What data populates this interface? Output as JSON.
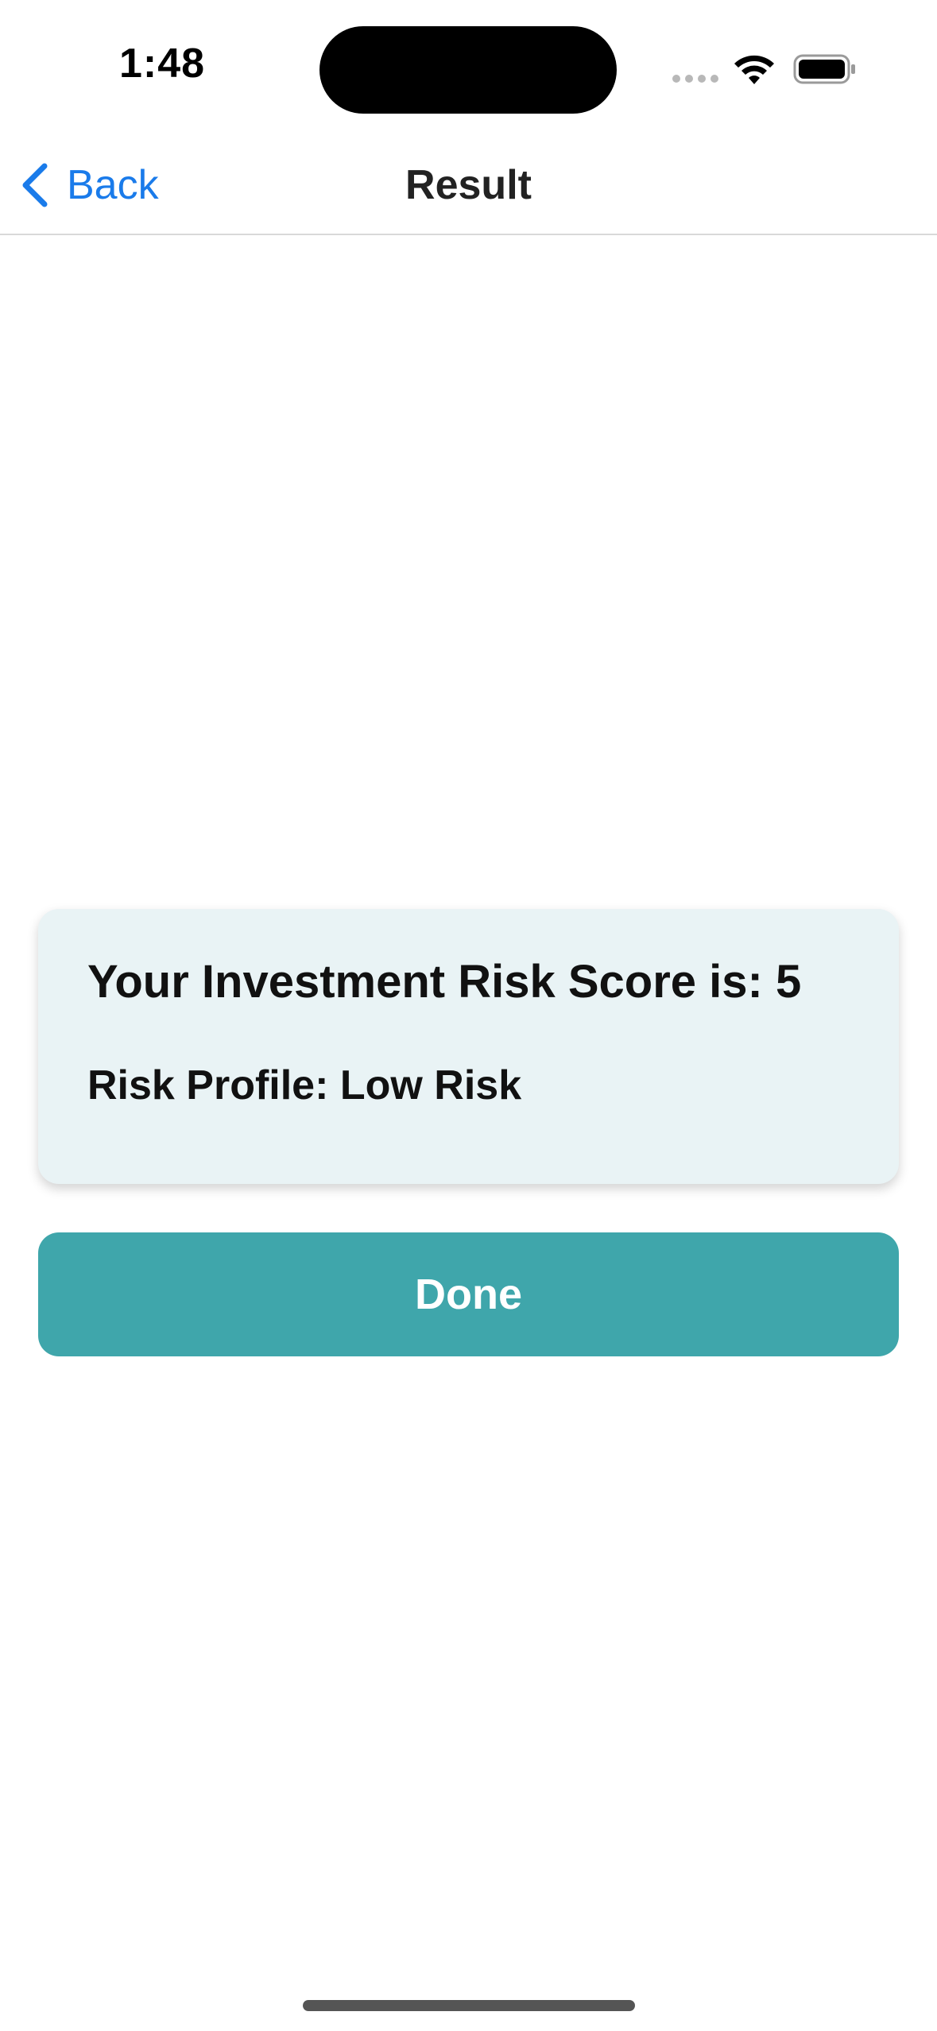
{
  "status_bar": {
    "time": "1:48"
  },
  "nav": {
    "back_label": "Back",
    "title": "Result"
  },
  "result": {
    "score_text": "Your Investment Risk Score is: 5",
    "profile_text": "Risk Profile: Low Risk"
  },
  "actions": {
    "done_label": "Done"
  },
  "icons": {
    "back": "chevron-left-icon",
    "signal": "cellular-signal-icon",
    "wifi": "wifi-icon",
    "battery": "battery-icon"
  },
  "colors": {
    "accent_link": "#1a7bea",
    "card_background": "#e9f3f5",
    "done_button": "#3fa6ab",
    "done_text": "#ffffff"
  }
}
